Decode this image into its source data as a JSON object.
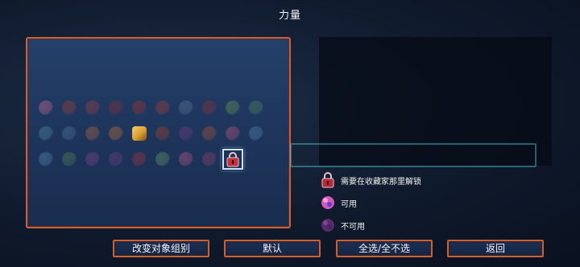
{
  "title": "力量",
  "grid": {
    "slots": [
      {
        "icon": "pink-orb-icon",
        "color": "#c05a9a",
        "state": "unavailable"
      },
      {
        "icon": "red-tornado-icon",
        "color": "#9a3a3a",
        "state": "unavailable"
      },
      {
        "icon": "red-claw-icon",
        "color": "#9a3a42",
        "state": "unavailable"
      },
      {
        "icon": "red-wings-icon",
        "color": "#8a2c40",
        "state": "unavailable"
      },
      {
        "icon": "red-flame-icon",
        "color": "#a03030",
        "state": "unavailable"
      },
      {
        "icon": "syringe-icon",
        "color": "#a03a34",
        "state": "unavailable"
      },
      {
        "icon": "blue-portal-icon",
        "color": "#4a6a9a",
        "state": "unavailable"
      },
      {
        "icon": "red-feather-icon",
        "color": "#8a3040",
        "state": "unavailable"
      },
      {
        "icon": "green-brain-icon",
        "color": "#4a8a4a",
        "state": "unavailable"
      },
      {
        "icon": "green-rune-icon",
        "color": "#3a7a5a",
        "state": "unavailable"
      },
      {
        "icon": "blue-eye-icon",
        "color": "#3a7aa0",
        "state": "unavailable"
      },
      {
        "icon": "blue-leaf-icon",
        "color": "#3a6a9a",
        "state": "unavailable"
      },
      {
        "icon": "orange-mask-icon",
        "color": "#a05a3a",
        "state": "unavailable"
      },
      {
        "icon": "orange-claws-icon",
        "color": "#b06030",
        "state": "unavailable"
      },
      {
        "icon": "golden-idol-icon",
        "color": "#d9a030",
        "state": "available"
      },
      {
        "icon": "red-serpent-icon",
        "color": "#a03a2a",
        "state": "unavailable"
      },
      {
        "icon": "purple-bat-icon",
        "color": "#6a3a8a",
        "state": "unavailable"
      },
      {
        "icon": "comet-icon",
        "color": "#a04a3a",
        "state": "unavailable"
      },
      {
        "icon": "pink-crab-icon",
        "color": "#b04a7a",
        "state": "unavailable"
      },
      {
        "icon": "blue-splash-icon",
        "color": "#3a7ab0",
        "state": "unavailable"
      },
      {
        "icon": "blue-bolt-icon",
        "color": "#3a7ab0",
        "state": "unavailable"
      },
      {
        "icon": "green-sickle-icon",
        "color": "#3a7a4a",
        "state": "unavailable"
      },
      {
        "icon": "purple-feather-icon",
        "color": "#7a3a9a",
        "state": "unavailable"
      },
      {
        "icon": "purple-web-icon",
        "color": "#6a3a8a",
        "state": "unavailable"
      },
      {
        "icon": "red-potion-icon",
        "color": "#a03040",
        "state": "unavailable"
      },
      {
        "icon": "green-gem-icon",
        "color": "#4a8a5a",
        "state": "unavailable"
      },
      {
        "icon": "pink-eye-icon",
        "color": "#b04a8a",
        "state": "unavailable"
      },
      {
        "icon": "purple-mouth-icon",
        "color": "#8a3a6a",
        "state": "unavailable"
      },
      {
        "icon": "padlock-icon",
        "color": "#c0303a",
        "state": "locked-selected"
      }
    ]
  },
  "legend": {
    "locked": {
      "icon": "padlock-icon",
      "label": "需要在收藏家那里解锁"
    },
    "available": {
      "icon": "pink-orb-available-icon",
      "label": "可用"
    },
    "unavailable": {
      "icon": "pink-orb-unavailable-icon",
      "label": "不可用"
    }
  },
  "buttons": {
    "change_group": "改变对象组别",
    "default": "默认",
    "select_all": "全选/全不选",
    "back": "返回"
  },
  "colors": {
    "frame_accent": "#c9623a",
    "panel_blue": "#1d3359",
    "selection_outline": "#cfe6ff"
  }
}
